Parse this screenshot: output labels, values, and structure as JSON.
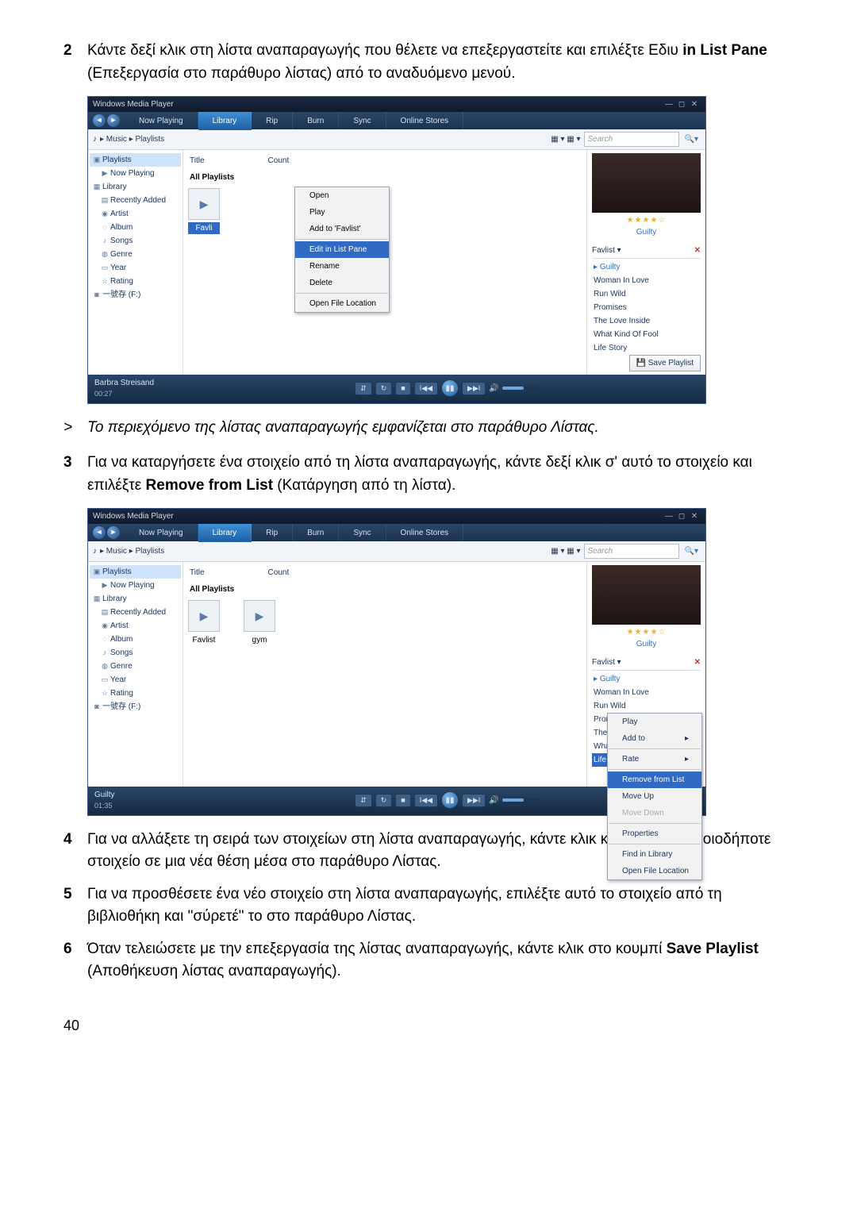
{
  "steps": {
    "s2": {
      "num": "2",
      "text_a": "Κάντε δεξί κλικ στη λίστα αναπαραγωγής που θέλετε να επεξεργαστείτε και επιλέξτε Εδιυ ",
      "bold": "in List Pane",
      "text_b": " (Επεξεργασία στο παράθυρο λίστας) από το αναδυόμενο μενού."
    },
    "note": {
      "prefix": ">",
      "text": "Το περιεχόμενο της λίστας αναπαραγωγής εμφανίζεται στο παράθυρο Λίστας."
    },
    "s3": {
      "num": "3",
      "text_a": "Για να καταργήσετε ένα στοιχείο από τη λίστα αναπαραγωγής, κάντε δεξί κλικ σ' αυτό το στοιχείο και επιλέξτε ",
      "bold": "Remove from List",
      "text_b": " (Κατάργηση από τη λίστα)."
    },
    "s4": {
      "num": "4",
      "text": "Για να αλλάξετε τη σειρά των στοιχείων στη λίστα αναπαραγωγής, κάντε κλικ και \"σύρετε\" οποιοδήποτε στοιχείο σε μια νέα θέση μέσα στο παράθυρο Λίστας."
    },
    "s5": {
      "num": "5",
      "text": "Για να προσθέσετε ένα νέο στοιχείο στη λίστα αναπαραγωγής, επιλέξτε αυτό το στοιχείο από τη βιβλιοθήκη και \"σύρετέ\" το στο παράθυρο Λίστας."
    },
    "s6": {
      "num": "6",
      "text_a": "Όταν τελειώσετε με την επεξεργασία της λίστας αναπαραγωγής, κάντε κλικ στο κουμπί ",
      "bold": "Save Playlist",
      "text_b": " (Αποθήκευση λίστας αναπαραγωγής)."
    }
  },
  "wmp": {
    "title": "Windows Media Player",
    "tabs": [
      "Now Playing",
      "Library",
      "Rip",
      "Burn",
      "Sync",
      "Online Stores"
    ],
    "breadcrumb": "▸ Music ▸ Playlists",
    "search_placeholder": "Search",
    "search_icon_left": "▦ ▾  ▦ ▾",
    "tree": {
      "playlists": "Playlists",
      "nowplaying": "Now Playing",
      "library": "Library",
      "recent": "Recently Added",
      "artist": "Artist",
      "album": "Album",
      "songs": "Songs",
      "genre": "Genre",
      "year": "Year",
      "rating": "Rating",
      "drive": "一號存 (F:)"
    },
    "cols": {
      "title": "Title",
      "count": "Count"
    },
    "all_playlists": "All Playlists",
    "thumbs": {
      "a": "Favlist",
      "b": "gym"
    },
    "ctx1": {
      "open": "Open",
      "play": "Play",
      "addto": "Add to 'Favlist'",
      "edit": "Edit in List Pane",
      "rename": "Rename",
      "delete": "Delete",
      "openloc": "Open File Location"
    },
    "ctx2": {
      "play": "Play",
      "addto": "Add to",
      "rate": "Rate",
      "remove": "Remove from List",
      "moveup": "Move Up",
      "movedown": "Move Down",
      "props": "Properties",
      "findlib": "Find in Library",
      "openloc": "Open File Location"
    },
    "right": {
      "stars": "★★★★☆",
      "album": "Guilty",
      "playlist_label": "Favlist ▾",
      "tracks": [
        "Guilty",
        "Woman In Love",
        "Run Wild",
        "Promises",
        "The Love Inside",
        "What Kind Of Fool",
        "Life Story"
      ],
      "save": "Save Playlist"
    },
    "controls": {
      "track1": "Barbra Streisand",
      "time1": "00:27",
      "track2": "Guilty",
      "time2": "01:35",
      "shuffle": "⇵",
      "repeat": "↻",
      "stop": "■",
      "prev": "I◀◀",
      "play": "▮▮",
      "next": "▶▶I",
      "mute": "🔊"
    }
  },
  "page_number": "40"
}
